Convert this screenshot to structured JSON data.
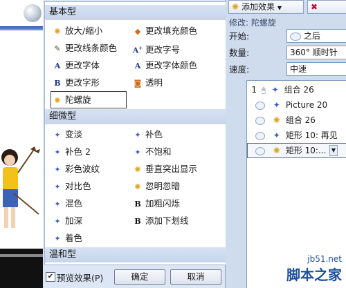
{
  "dialog": {
    "groups": [
      {
        "label": "基本型",
        "items": [
          {
            "label": "放大/缩小",
            "icon": "star-spin-icon"
          },
          {
            "label": "更改填充颜色",
            "icon": "fill-bucket-icon"
          },
          {
            "label": "更改线条颜色",
            "icon": "pen-line-icon"
          },
          {
            "label": "更改字号",
            "icon": "font-size-icon"
          },
          {
            "label": "更改字体",
            "icon": "font-icon"
          },
          {
            "label": "更改字体颜色",
            "icon": "font-color-icon"
          },
          {
            "label": "更改字形",
            "icon": "font-style-icon"
          },
          {
            "label": "透明",
            "icon": "transparency-icon"
          },
          {
            "label": "陀螺旋",
            "icon": "spin-icon"
          }
        ]
      },
      {
        "label": "细微型",
        "items": [
          {
            "label": "变淡",
            "icon": "sparkle-icon"
          },
          {
            "label": "补色",
            "icon": "sparkle-icon"
          },
          {
            "label": "补色 2",
            "icon": "sparkle-icon"
          },
          {
            "label": "不饱和",
            "icon": "sparkle-icon"
          },
          {
            "label": "彩色波纹",
            "icon": "sparkle-icon"
          },
          {
            "label": "垂直突出显示",
            "icon": "star-icon"
          },
          {
            "label": "对比色",
            "icon": "sparkle-icon"
          },
          {
            "label": "忽明忽暗",
            "icon": "star-icon"
          },
          {
            "label": "混色",
            "icon": "sparkle-icon"
          },
          {
            "label": "加粗闪烁",
            "icon": "bold-icon"
          },
          {
            "label": "加深",
            "icon": "sparkle-icon"
          },
          {
            "label": "添加下划线",
            "icon": "bold-icon"
          },
          {
            "label": "着色",
            "icon": "sparkle-icon"
          }
        ]
      },
      {
        "label": "温和型",
        "items": []
      }
    ],
    "selected_effect": "陀螺旋",
    "preview_label": "预览效果(P)",
    "preview_checked": true,
    "ok_label": "确定",
    "cancel_label": "取消"
  },
  "task_pane": {
    "add_effect_label": "添加效果",
    "add_effect_arrow": "▼",
    "modify_label": "修改: 陀螺旋",
    "properties": [
      {
        "label": "开始:",
        "value": "之后",
        "icon": true
      },
      {
        "label": "数量:",
        "value": "360° 顺时针",
        "icon": false
      },
      {
        "label": "速度:",
        "value": "中速",
        "icon": false
      }
    ],
    "animations": [
      {
        "number": "1",
        "trigger": "mouse",
        "effect_icon": "sparkle-icon",
        "label": "组合 26"
      },
      {
        "number": "",
        "trigger": "clock",
        "effect_icon": "sparkle-icon",
        "label": "Picture 20"
      },
      {
        "number": "",
        "trigger": "clock",
        "effect_icon": "star-icon",
        "label": "组合 26"
      },
      {
        "number": "",
        "trigger": "clock",
        "effect_icon": "sparkle-icon",
        "label": "矩形 10: 再见"
      },
      {
        "number": "",
        "trigger": "clock",
        "effect_icon": "star-icon",
        "label": "矩形 10:..."
      }
    ]
  },
  "watermark": {
    "url": "jb51.net",
    "site": "脚本之家"
  }
}
